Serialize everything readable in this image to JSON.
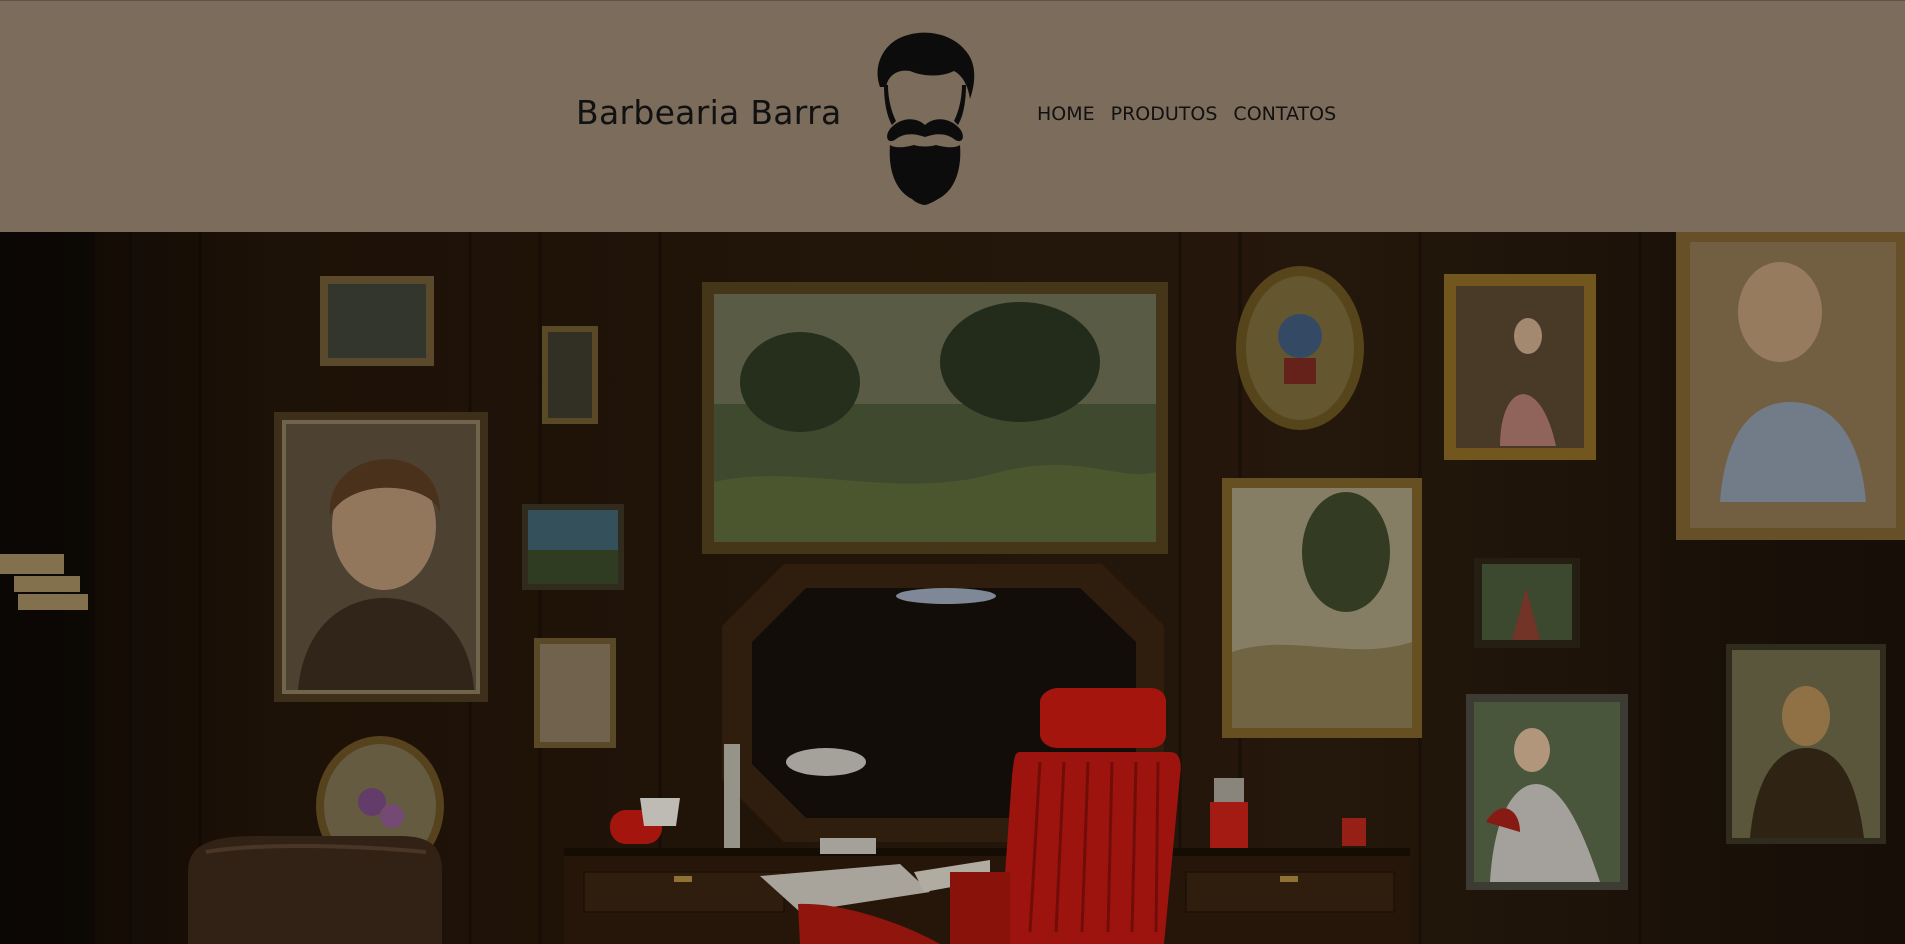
{
  "header": {
    "brand": "Barbearia Barra",
    "nav": [
      "HOME",
      "PRODUTOS",
      "CONTATOS"
    ]
  },
  "logo": {
    "icon": "bearded-man-icon"
  },
  "hero": {
    "icon": "barbershop-interior-image"
  },
  "colors": {
    "header_bg": "#7b6c5b",
    "chair": "#c91b10"
  }
}
